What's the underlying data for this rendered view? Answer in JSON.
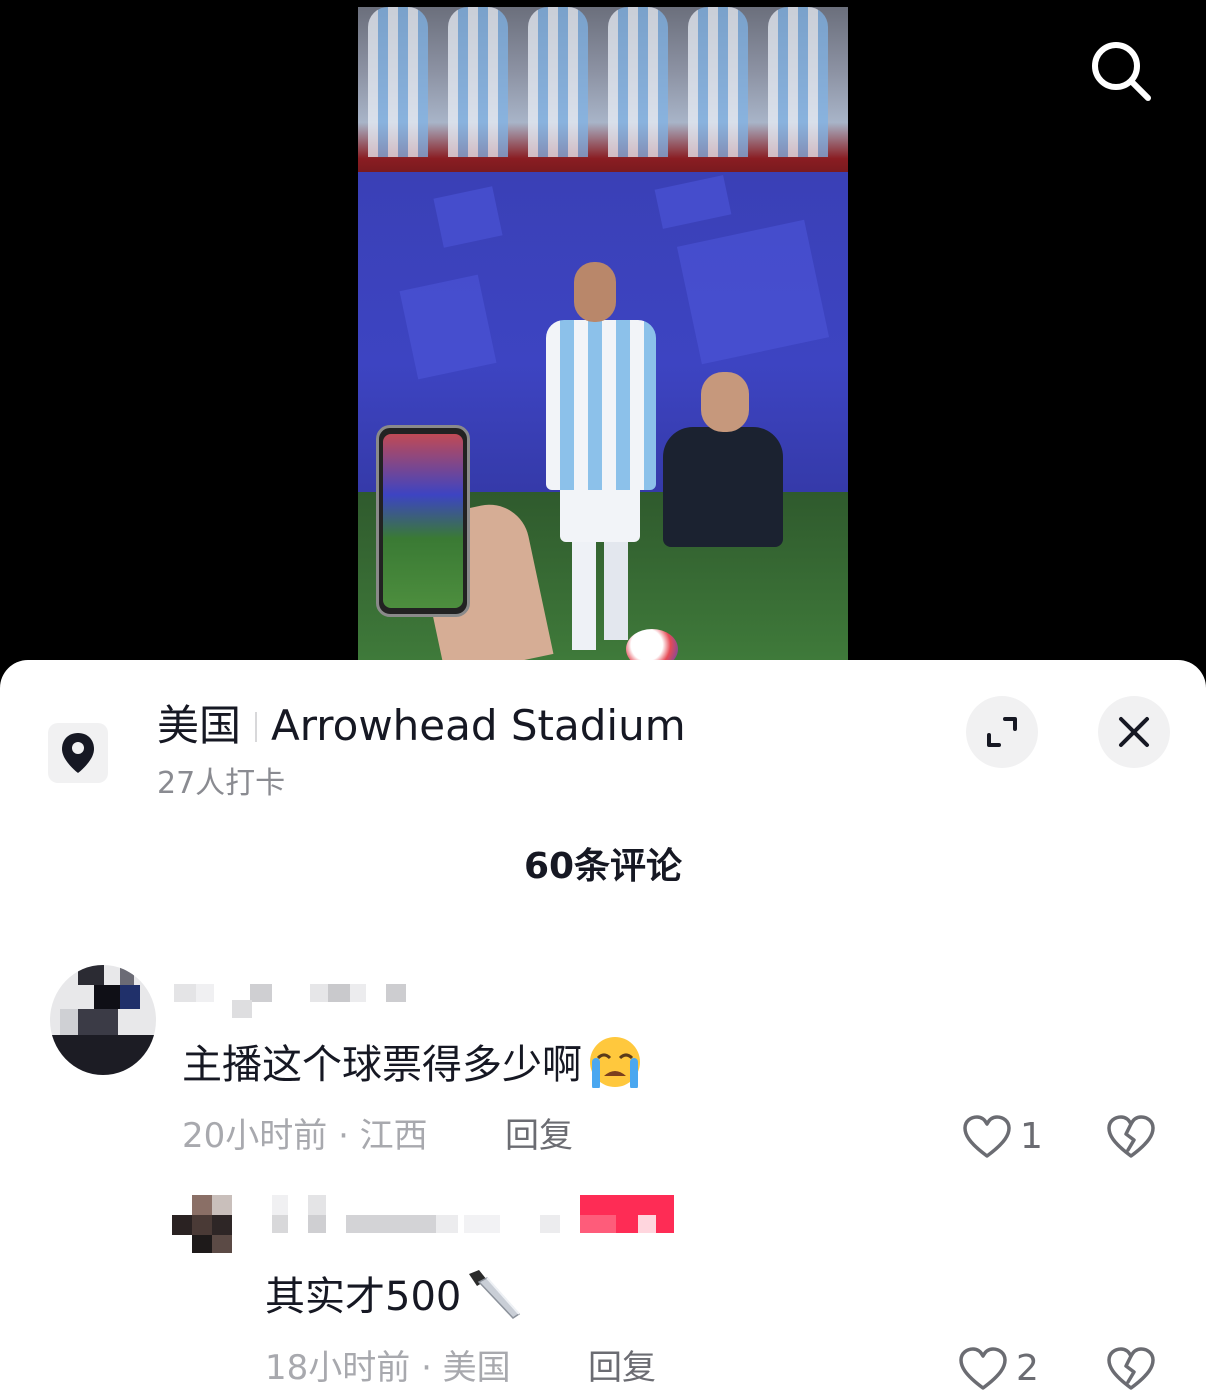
{
  "location": {
    "country": "美国",
    "place": "Arrowhead Stadium",
    "checkins": "27人打卡"
  },
  "comments_header": "60条评论",
  "comments": [
    {
      "text": "主播这个球票得多少啊",
      "emoji": "loudly-crying-face",
      "time_region": "20小时前 · 江西",
      "reply_label": "回复",
      "likes": "1"
    },
    {
      "text": "其实才500",
      "emoji": "knife",
      "time_region": "18小时前 · 美国",
      "reply_label": "回复",
      "likes": "2"
    }
  ],
  "colors": {
    "accent_red": "#fe2c55",
    "text_primary": "#161823",
    "text_secondary": "#8a8b91"
  }
}
